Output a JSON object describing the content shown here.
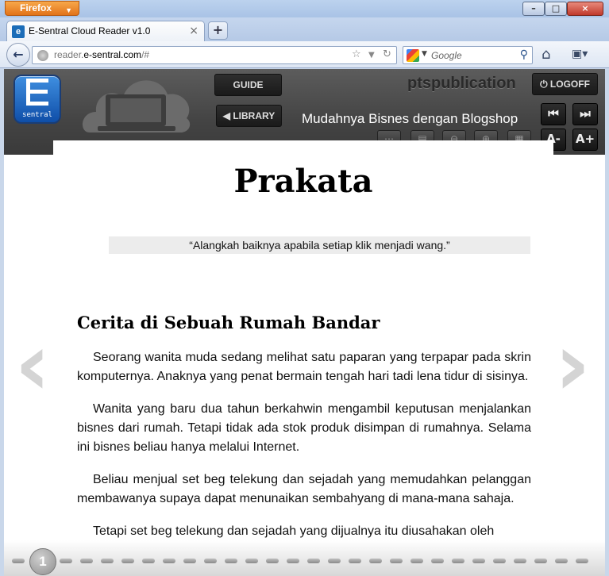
{
  "browser": {
    "menu_button": "Firefox",
    "tab_title": "E-Sentral Cloud Reader v1.0",
    "tab_close": "×",
    "new_tab": "+",
    "url_prefix": "reader.",
    "url_host": "e-sentral.com",
    "url_path": "/#",
    "search_placeholder": "Google",
    "window_controls": [
      "–",
      "□",
      "×"
    ]
  },
  "reader": {
    "logo_text": "sentral",
    "guide_label": "GUIDE",
    "library_label": "LIBRARY",
    "publisher": "ptspublication",
    "logoff_label": "LOGOFF",
    "book_title": "Mudahnya Bisnes dengan Blogshop",
    "nav_first": "◀",
    "nav_last": "▶",
    "font_smaller": "A-",
    "font_larger": "A+"
  },
  "page": {
    "title": "Prakata",
    "quote": "“Alangkah baiknya apabila setiap klik menjadi wang.”",
    "subtitle": "Cerita di Sebuah Rumah Bandar",
    "paragraphs": [
      "Seorang wanita muda sedang melihat satu paparan yang terpapar pada skrin komputernya. Anaknya yang penat bermain tengah hari tadi lena tidur di sisinya.",
      "Wanita yang baru dua tahun berkahwin mengambil keputusan menjalankan bisnes dari rumah. Tetapi tidak ada stok produk disimpan di rumahnya. Selama ini bisnes beliau hanya melalui Internet.",
      "Beliau menjual set beg telekung dan sejadah yang memudahkan pelanggan membawanya supaya dapat menunaikan sembahyang di mana-mana sahaja.",
      "Tetapi set beg telekung dan sejadah yang dijualnya itu diusahakan oleh"
    ],
    "current_page": "1"
  },
  "icons": {
    "prev": "chevron-left-icon",
    "next": "chevron-right-icon"
  }
}
